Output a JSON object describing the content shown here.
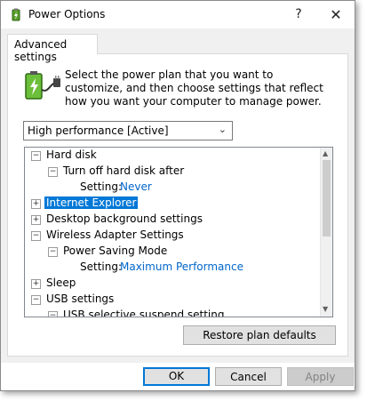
{
  "window": {
    "title": "Power Options",
    "help_glyph": "?",
    "close_glyph": "✕"
  },
  "tab": {
    "label": "Advanced settings"
  },
  "description": "Select the power plan that you want to customize, and then choose settings that reflect how you want your computer to manage power.",
  "plan_dropdown": {
    "selected": "High performance [Active]"
  },
  "tree": {
    "hard_disk": "Hard disk",
    "turn_off_hdd": "Turn off hard disk after",
    "setting_label": "Setting:",
    "turn_off_hdd_value": "Never",
    "internet_explorer": "Internet Explorer",
    "desktop_background": "Desktop background settings",
    "wireless_adapter": "Wireless Adapter Settings",
    "power_saving_mode": "Power Saving Mode",
    "power_saving_value": "Maximum Performance",
    "sleep": "Sleep",
    "usb": "USB settings",
    "usb_suspend": "USB selective suspend setting",
    "collapse_glyph": "−",
    "expand_glyph": "+"
  },
  "buttons": {
    "restore": "Restore plan defaults",
    "ok": "OK",
    "cancel": "Cancel",
    "apply": "Apply"
  },
  "colors": {
    "selection": "#0078d7",
    "link": "#0066cc"
  }
}
